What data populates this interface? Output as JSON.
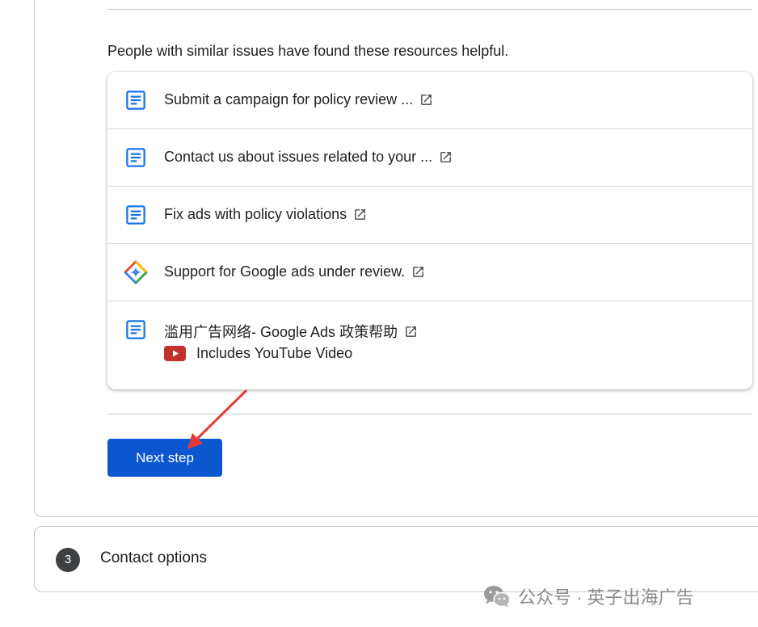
{
  "intro_text": "People with similar issues have found these resources helpful.",
  "resources": [
    {
      "label": "Submit a campaign for policy review ...",
      "icon": "document-icon"
    },
    {
      "label": "Contact us about issues related to your ...",
      "icon": "document-icon"
    },
    {
      "label": "Fix ads with policy violations",
      "icon": "document-icon"
    },
    {
      "label": "Support for Google ads under review.",
      "icon": "gemini-sparkle-icon"
    },
    {
      "label": "滥用广告网络- Google Ads 政策帮助",
      "icon": "document-icon",
      "sub_label": "Includes YouTube Video",
      "sub_icon": "youtube-icon"
    }
  ],
  "next_button": "Next step",
  "contact": {
    "step": "3",
    "title": "Contact options"
  },
  "watermark": "公众号 · 英子出海广告",
  "colors": {
    "accent": "#0b57d0",
    "doc_icon": "#1a73e8",
    "youtube": "#c4302b",
    "annotation_arrow": "#e53935"
  }
}
